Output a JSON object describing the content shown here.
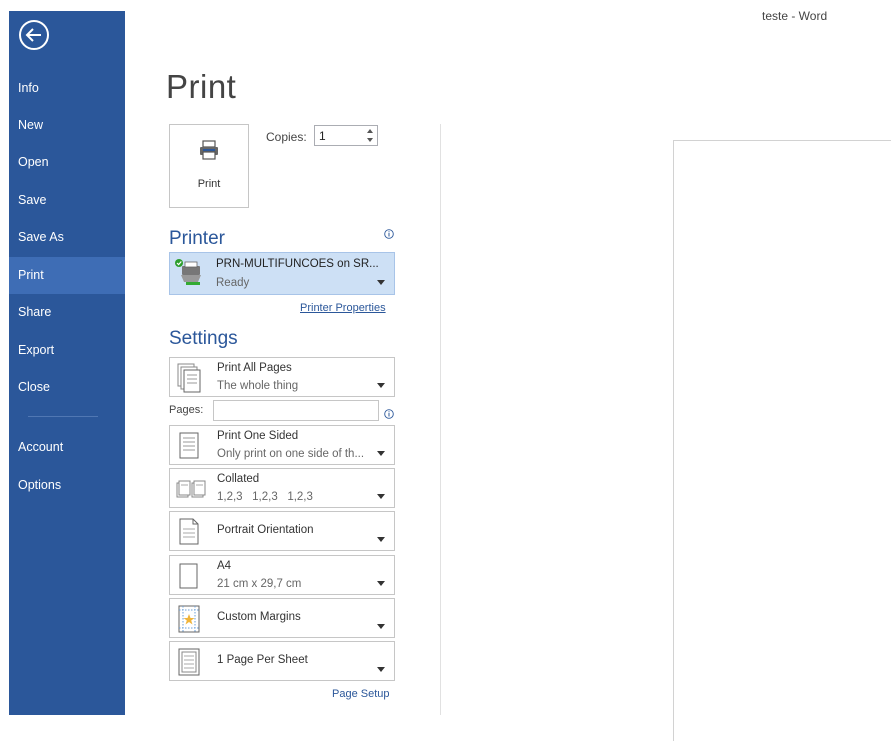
{
  "window": {
    "title": "teste - Word"
  },
  "sidebar": {
    "items": [
      {
        "label": "Info"
      },
      {
        "label": "New"
      },
      {
        "label": "Open"
      },
      {
        "label": "Save"
      },
      {
        "label": "Save As"
      },
      {
        "label": "Print",
        "active": true
      },
      {
        "label": "Share"
      },
      {
        "label": "Export"
      },
      {
        "label": "Close"
      },
      {
        "label": "Account"
      },
      {
        "label": "Options"
      }
    ]
  },
  "page": {
    "title": "Print"
  },
  "print": {
    "button_label": "Print",
    "copies_label": "Copies:",
    "copies_value": "1"
  },
  "printer": {
    "section_title": "Printer",
    "name": "PRN-MULTIFUNCOES on SR...",
    "status": "Ready",
    "properties_link": "Printer Properties"
  },
  "settings": {
    "section_title": "Settings",
    "pages_label": "Pages:",
    "pages_value": "",
    "items": [
      {
        "main": "Print All Pages",
        "sub": "The whole thing"
      },
      {
        "main": "Print One Sided",
        "sub": "Only print on one side of th..."
      },
      {
        "main": "Collated",
        "sub": "1,2,3   1,2,3   1,2,3"
      },
      {
        "main": "Portrait Orientation"
      },
      {
        "main": "A4",
        "sub": "21 cm x 29,7 cm"
      },
      {
        "main": "Custom Margins"
      },
      {
        "main": "1 Page Per Sheet"
      }
    ],
    "page_setup_link": "Page Setup"
  },
  "colors": {
    "sidebar_bg": "#2b579a",
    "sidebar_active": "#3e6db5",
    "accent": "#2b579a",
    "printer_selected_bg": "#cde0f5"
  }
}
